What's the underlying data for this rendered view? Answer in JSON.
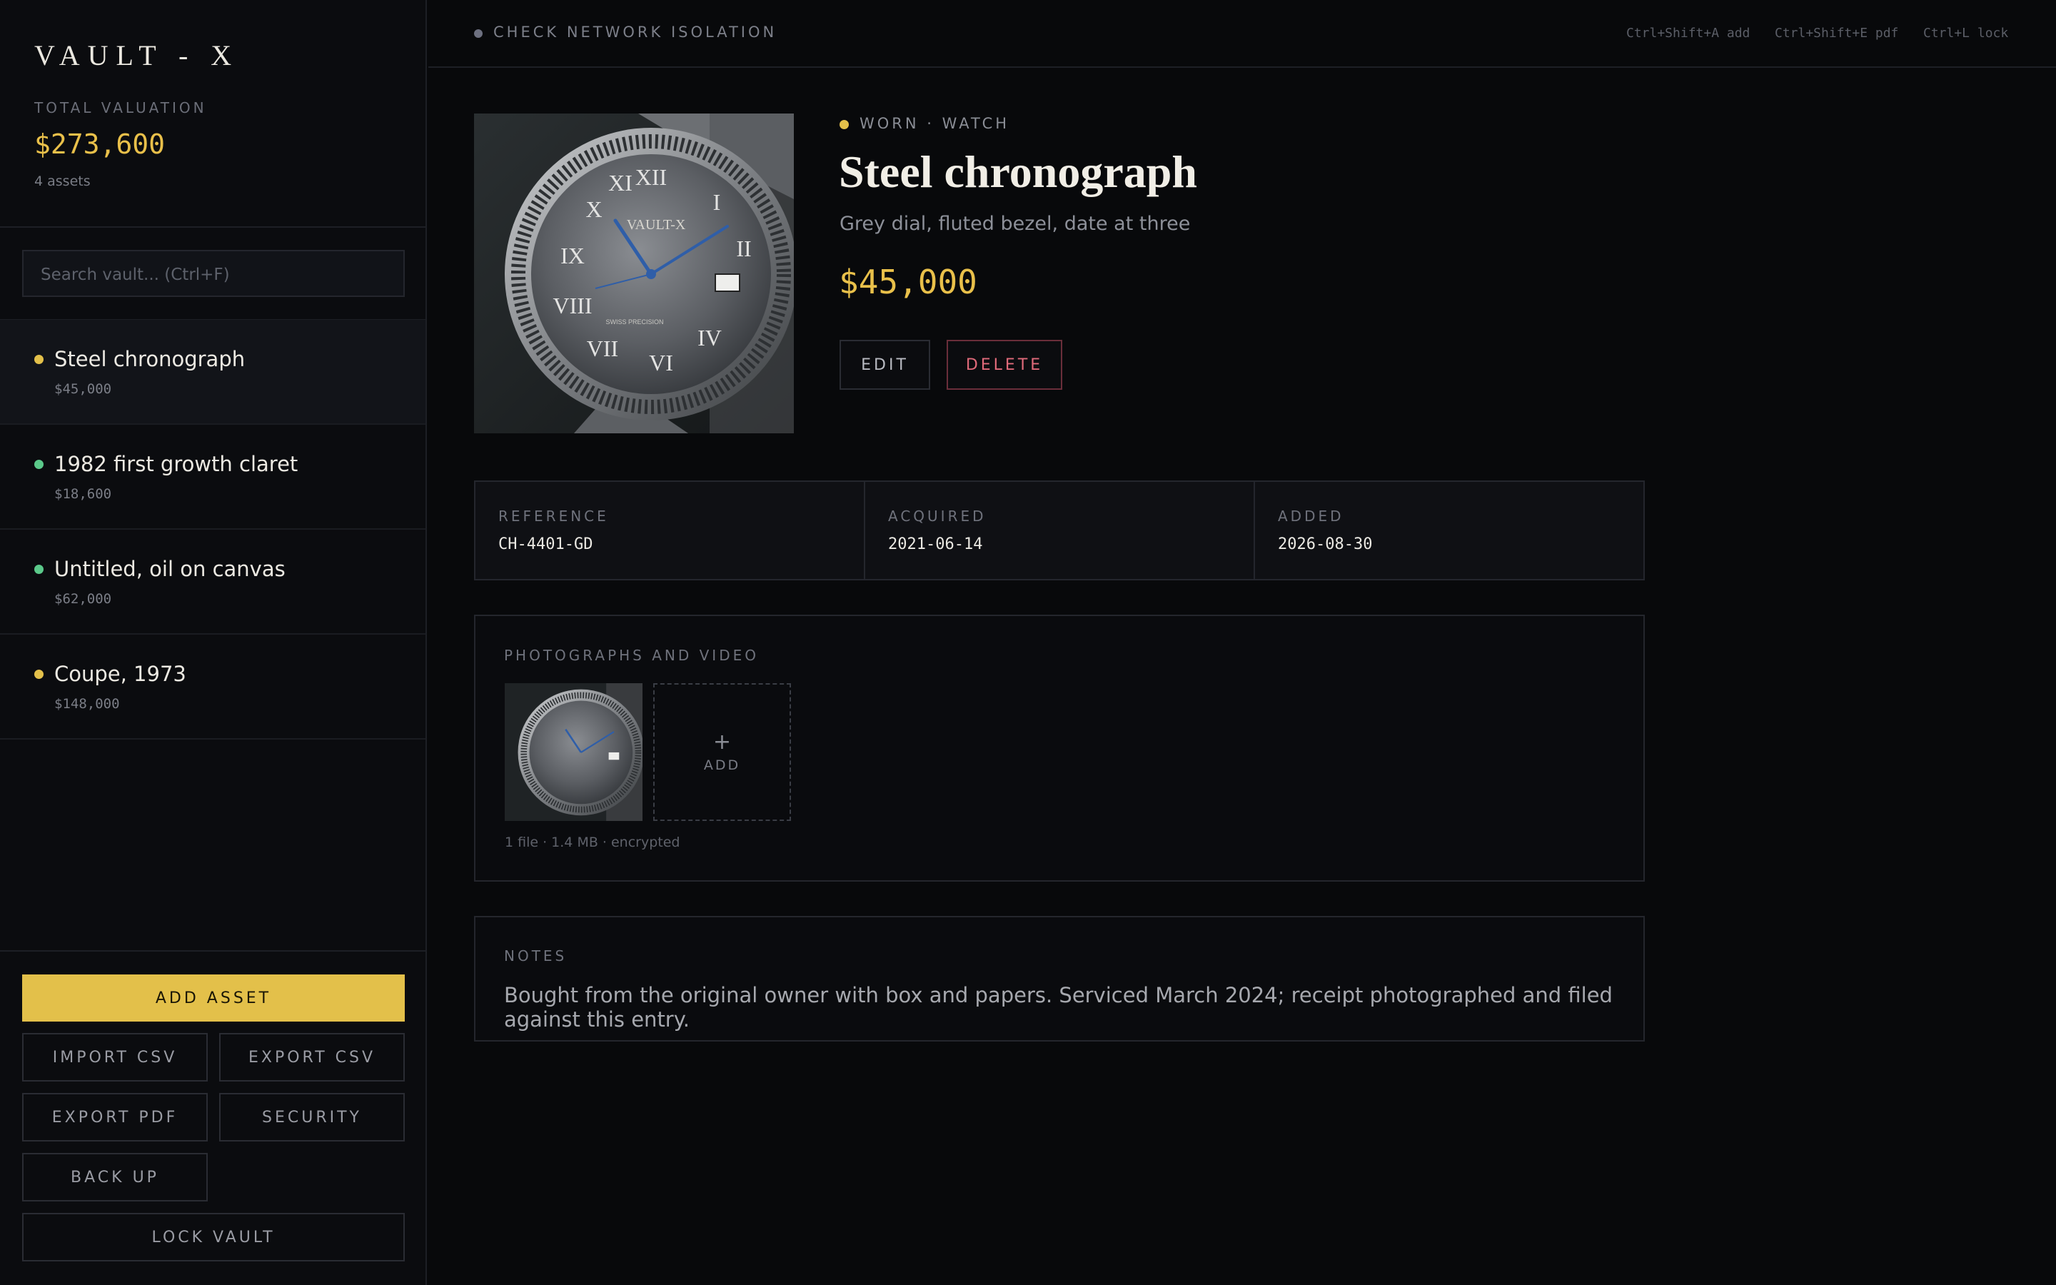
{
  "app": {
    "brand": "VAULT - X",
    "total_label": "TOTAL VALUATION",
    "total_value": "$273,600",
    "asset_count": "4 assets"
  },
  "search": {
    "placeholder": "Search vault...  (Ctrl+F)"
  },
  "assets": [
    {
      "name": "Steel chronograph",
      "price": "$45,000",
      "dot_color": "#e3c04a",
      "active": true
    },
    {
      "name": "1982 first growth claret",
      "price": "$18,600",
      "dot_color": "#5bc98a",
      "active": false
    },
    {
      "name": "Untitled, oil on canvas",
      "price": "$62,000",
      "dot_color": "#5bc98a",
      "active": false
    },
    {
      "name": "Coupe, 1973",
      "price": "$148,000",
      "dot_color": "#e3c04a",
      "active": false
    }
  ],
  "actions": {
    "add": "ADD ASSET",
    "import_csv": "IMPORT CSV",
    "export_csv": "EXPORT CSV",
    "export_pdf": "EXPORT PDF",
    "security": "SECURITY",
    "back_up": "BACK UP",
    "lock": "LOCK VAULT"
  },
  "topbar": {
    "network": "CHECK NETWORK ISOLATION",
    "shortcuts": [
      "Ctrl+Shift+A add",
      "Ctrl+Shift+E pdf",
      "Ctrl+L lock"
    ]
  },
  "detail": {
    "kind": "WORN · WATCH",
    "title": "Steel chronograph",
    "subtitle": "Grey dial, fluted bezel, date at three",
    "price": "$45,000",
    "edit": "EDIT",
    "delete": "DELETE",
    "dial_brand": "VAULT-X",
    "dial_sub": "SWISS PRECISION",
    "meta": [
      {
        "label": "REFERENCE",
        "value": "CH-4401-GD"
      },
      {
        "label": "ACQUIRED",
        "value": "2021-06-14"
      },
      {
        "label": "ADDED",
        "value": "2026-08-30"
      }
    ],
    "media_label": "PHOTOGRAPHS AND VIDEO",
    "add_label": "ADD",
    "file_info": "1 file · 1.4 MB · encrypted",
    "notes_label": "NOTES",
    "notes": "Bought from the original owner with box and papers. Serviced March 2024; receipt photographed and filed against this entry."
  },
  "colors": {
    "accent": "#e3c04a",
    "danger": "#e06a7a",
    "background": "#08090b"
  }
}
